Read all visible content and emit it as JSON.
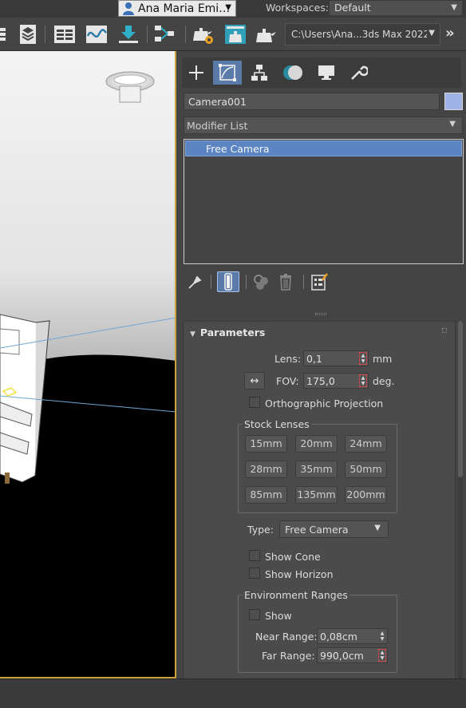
{
  "header": {
    "user_name": "Ana Maria Emi…",
    "workspaces_label": "Workspaces:",
    "workspace_value": "Default"
  },
  "toolbar": {
    "project_path": "C:\\Users\\Ana...3ds Max 2022",
    "icons": [
      "layer-list-icon",
      "layers-stack-icon",
      "scene-explorer-icon",
      "curve-editor-icon",
      "import-icon",
      "schematic-view-icon",
      "render-setup-icon",
      "rendered-frame-window-icon",
      "render-production-icon",
      "expand-more-icon"
    ]
  },
  "command_panel": {
    "tabs": [
      "create-tab",
      "modify-tab",
      "hierarchy-tab",
      "motion-tab",
      "display-tab",
      "utilities-tab"
    ],
    "active_tab": "modify-tab",
    "object_name": "Camera001",
    "object_color": "#9fb3e6",
    "modifier_list_label": "Modifier List",
    "stack_items": [
      "Free Camera"
    ],
    "parameters": {
      "header": "Parameters",
      "lens_label": "Lens:",
      "lens_value": "0,1",
      "lens_unit": "mm",
      "fov_label": "FOV:",
      "fov_value": "175,0",
      "fov_unit": "deg.",
      "fov_direction_symbol": "↔",
      "orthographic_label": "Orthographic Projection",
      "stock_lenses_label": "Stock Lenses",
      "stock_lenses": [
        "15mm",
        "20mm",
        "24mm",
        "28mm",
        "35mm",
        "50mm",
        "85mm",
        "135mm",
        "200mm"
      ],
      "type_label": "Type:",
      "type_value": "Free Camera",
      "show_cone_label": "Show Cone",
      "show_horizon_label": "Show Horizon",
      "env_ranges_label": "Environment Ranges",
      "env_show_label": "Show",
      "near_range_label": "Near Range:",
      "near_range_value": "0,08cm",
      "far_range_label": "Far Range:",
      "far_range_value": "990,0cm"
    }
  },
  "colors": {
    "accent_blue": "#5b85c2",
    "active_viewport_border": "#c8a23a",
    "panel_bg": "#444444"
  }
}
